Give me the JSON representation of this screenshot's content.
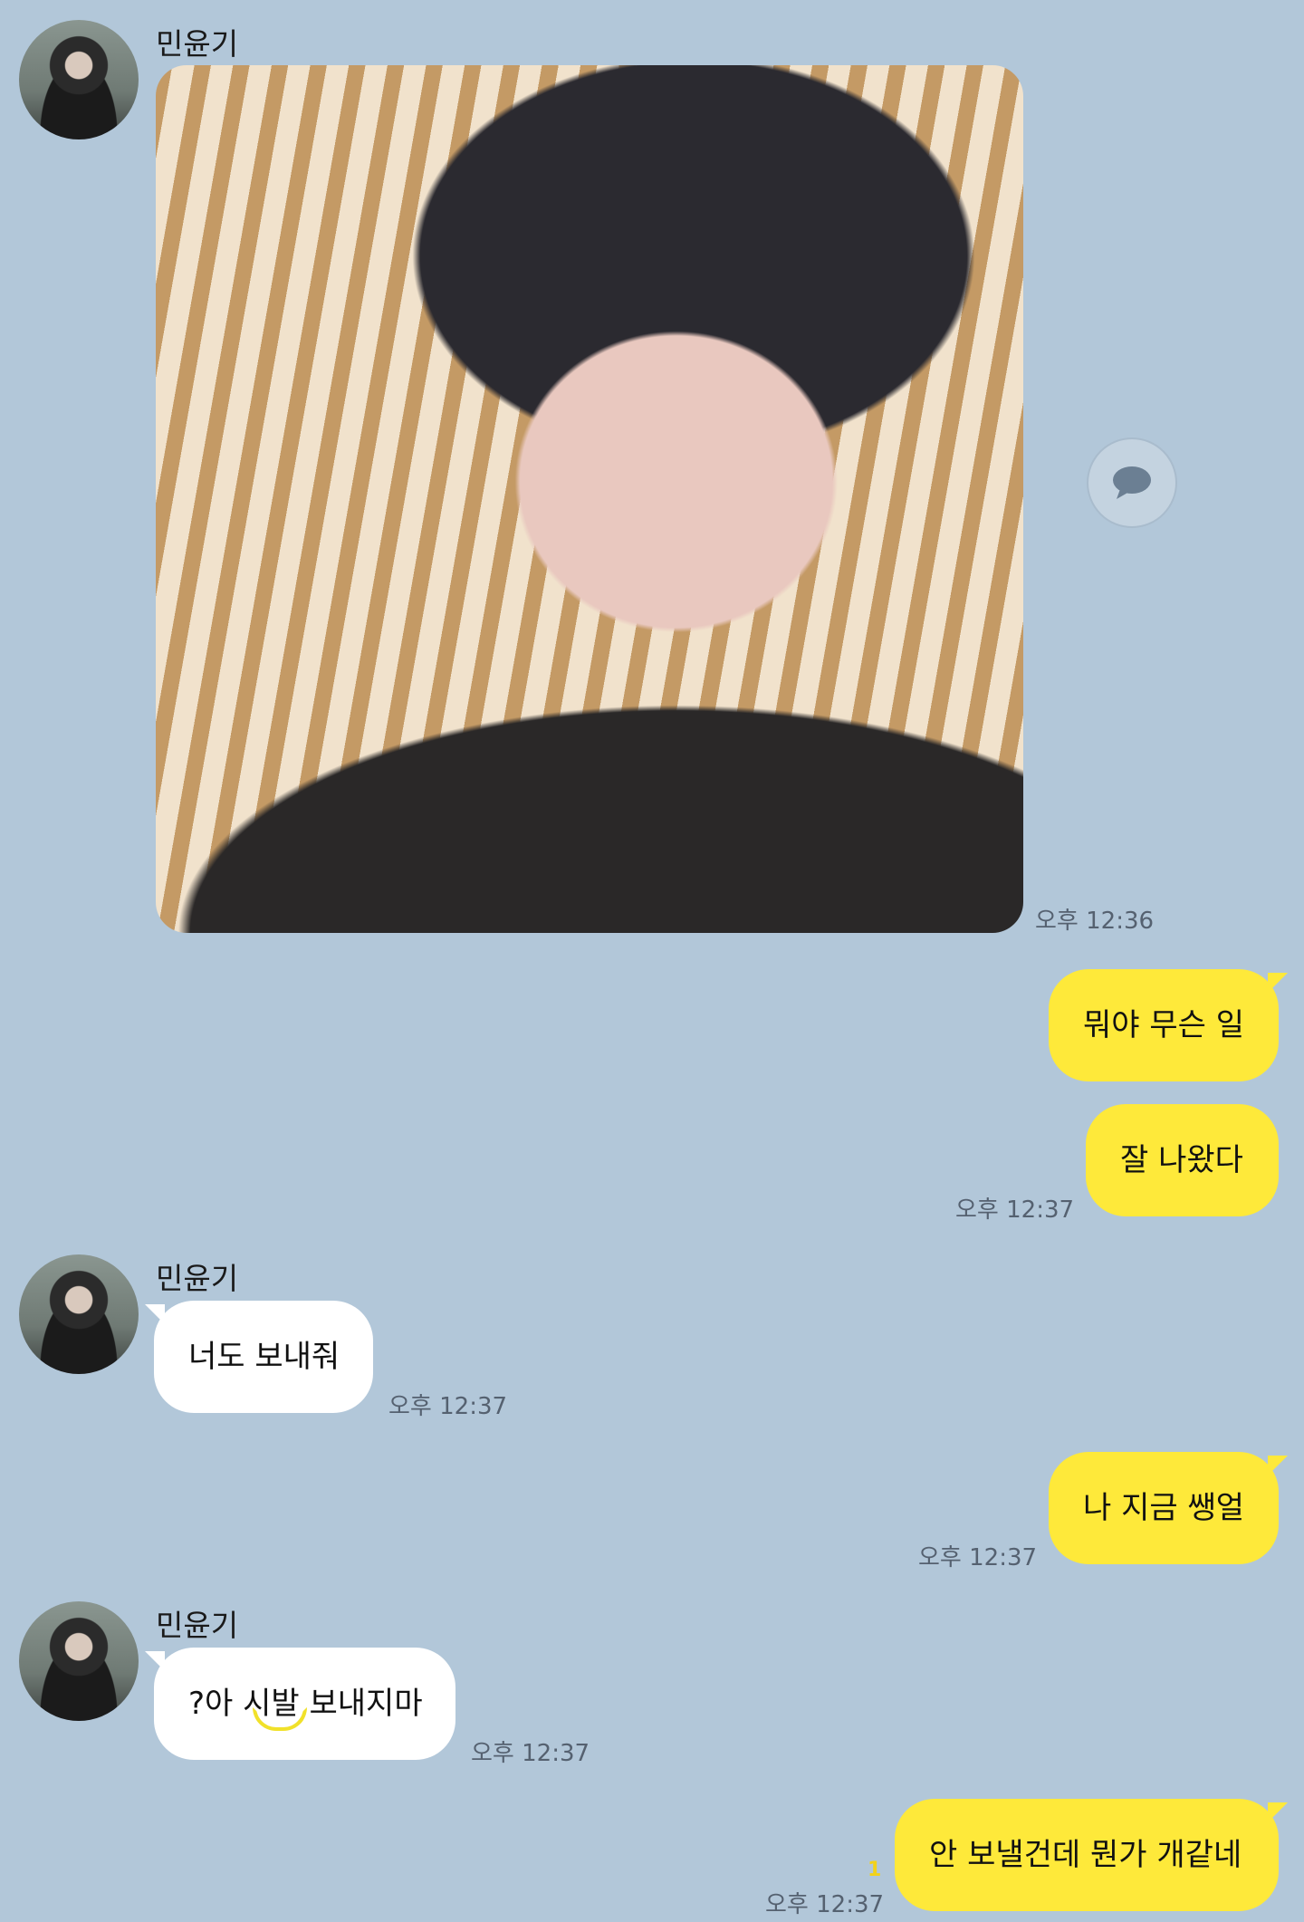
{
  "colors": {
    "background": "#b2c7d9",
    "incoming_bubble": "#ffffff",
    "outgoing_bubble": "#fee93a",
    "time_text": "#556170"
  },
  "messages": [
    {
      "sender": "민윤기",
      "type": "image",
      "time": "오후 12:36",
      "icon": "chat-bubble-icon"
    },
    {
      "direction": "out",
      "text": "뭐야 무슨 일"
    },
    {
      "direction": "out",
      "text": "잘 나왔다",
      "time": "오후 12:37"
    },
    {
      "sender": "민윤기",
      "direction": "in",
      "text": "너도 보내줘",
      "time": "오후 12:37"
    },
    {
      "direction": "out",
      "text": "나 지금 쌩얼",
      "time": "오후 12:37"
    },
    {
      "sender": "민윤기",
      "direction": "in",
      "text": "?아 시발 보내지마",
      "time": "오후 12:37"
    },
    {
      "direction": "out",
      "text": "안 보낼건데 뭔가 개같네",
      "time": "오후 12:37",
      "unread": "1"
    }
  ]
}
